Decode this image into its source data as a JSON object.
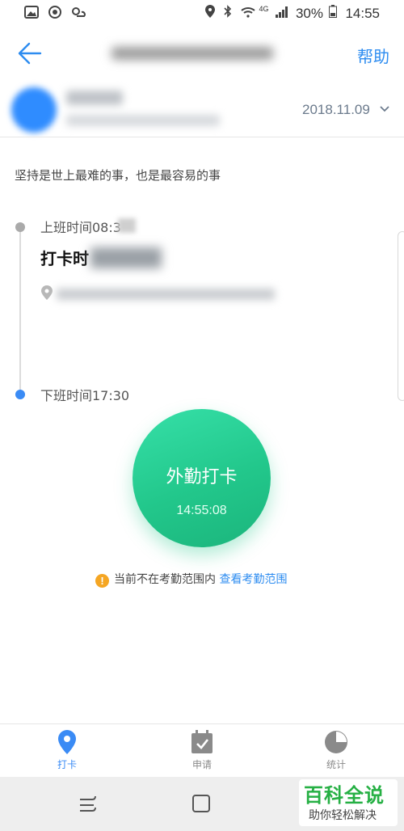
{
  "status_bar": {
    "battery": "30%",
    "time": "14:55",
    "network": "4G"
  },
  "header": {
    "help_label": "帮助"
  },
  "profile": {
    "date": "2018.11.09"
  },
  "motto": "坚持是世上最难的事，也是最容易的事",
  "timeline": {
    "start_label": "上班时间08:3",
    "punch_label": "打卡时",
    "end_label": "下班时间17:30"
  },
  "punch_button": {
    "label": "外勤打卡",
    "time": "14:55:08"
  },
  "notice": {
    "text": "当前不在考勤范围内",
    "link": "查看考勤范围"
  },
  "tabs": [
    {
      "label": "打卡",
      "icon": "location-pin-icon",
      "active": true
    },
    {
      "label": "申请",
      "icon": "calendar-check-icon",
      "active": false
    },
    {
      "label": "统计",
      "icon": "pie-chart-icon",
      "active": false
    }
  ],
  "watermark": {
    "title": "百科全说",
    "subtitle": "助你轻松解决"
  },
  "colors": {
    "accent": "#2d8cf0",
    "punch_green": "#22c78b",
    "warning": "#f5a623"
  }
}
